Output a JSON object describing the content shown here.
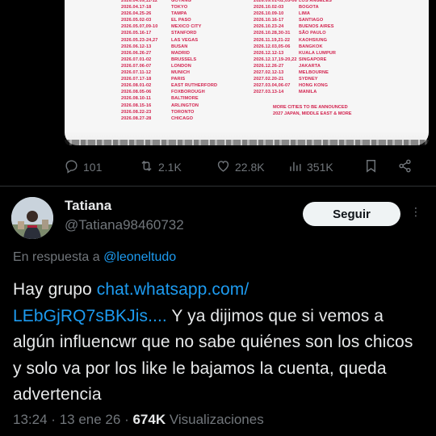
{
  "poster": {
    "left_rows": [
      {
        "date": "2026.04.09,11-12",
        "city": "GOYANG"
      },
      {
        "date": "2026.04.17-18",
        "city": "TOKYO"
      },
      {
        "date": "2026.04.25-26",
        "city": "TAMPA"
      },
      {
        "date": "2026.05.02-03",
        "city": "EL PASO"
      },
      {
        "date": "2026.05.07,09-10",
        "city": "MEXICO CITY"
      },
      {
        "date": "2026.05.16-17",
        "city": "STANFORD"
      },
      {
        "date": "2026.05.23-24,27",
        "city": "LAS VEGAS"
      },
      {
        "date": "2026.06.12-13",
        "city": "BUSAN"
      },
      {
        "date": "2026.06.26-27",
        "city": "MADRID"
      },
      {
        "date": "2026.07.01-02",
        "city": "BRUSSELS"
      },
      {
        "date": "2026.07.06-07",
        "city": "LONDON"
      },
      {
        "date": "2026.07.11-12",
        "city": "MUNICH"
      },
      {
        "date": "2026.07.17-18",
        "city": "PARIS"
      },
      {
        "date": "2026.08.01-02",
        "city": "EAST RUTHERFORD"
      },
      {
        "date": "2026.08.05-06",
        "city": "FOXBOROUGH"
      },
      {
        "date": "2026.08.10-11",
        "city": "BALTIMORE"
      },
      {
        "date": "2026.08.15-16",
        "city": "ARLINGTON"
      },
      {
        "date": "2026.08.22-23",
        "city": "TORONTO"
      },
      {
        "date": "2026.08.27-28",
        "city": "CHICAGO"
      }
    ],
    "right_rows": [
      {
        "date": "2026.09.01-02,05-06",
        "city": "LOS ANGELES"
      },
      {
        "date": "2026.10.02-03",
        "city": "BOGOTA"
      },
      {
        "date": "2026.10.09-10",
        "city": "LIMA"
      },
      {
        "date": "2026.10.16-17",
        "city": "SANTIAGO"
      },
      {
        "date": "2026.10.23-24",
        "city": "BUENOS AIRES"
      },
      {
        "date": "2026.10.28,30-31",
        "city": "SÃO PAULO"
      },
      {
        "date": "2026.11.19,21-22",
        "city": "KAOHSIUNG"
      },
      {
        "date": "2026.12.03,05-06",
        "city": "BANGKOK"
      },
      {
        "date": "2026.12.12-13",
        "city": "KUALA LUMPUR"
      },
      {
        "date": "2026.12.17,19-20,22",
        "city": "SINGAPORE"
      },
      {
        "date": "2026.12.26-27",
        "city": "JAKARTA"
      },
      {
        "date": "2027.02.12-13",
        "city": "MELBOURNE"
      },
      {
        "date": "2027.02.20-21",
        "city": "SYDNEY"
      },
      {
        "date": "2027.03.04,06-07",
        "city": "HONG KONG"
      },
      {
        "date": "2027.03.13-14",
        "city": "MANILA"
      }
    ],
    "note1": "MORE CITIES TO BE ANNOUNCED",
    "note2": "2027 JAPAN, MIDDLE EAST & MORE"
  },
  "actions": {
    "replies": "101",
    "reposts": "2.1K",
    "likes": "22.8K",
    "views": "351K"
  },
  "reply": {
    "name": "Tatiana",
    "handle": "@Tatiana98460732",
    "follow_label": "Seguir",
    "reply_prefix": "En respuesta a",
    "reply_mention": "@leoneltudo",
    "text_before": "Hay grupo ",
    "link_line1": "chat.whatsapp.com/",
    "link_line2": "LEbGjRQ7sBKJis....",
    "text_after": "  Y ya dijimos que si vemos a algún influencwr que no sabe quiénes son los chicos y solo va por los like le bajamos la cuenta,  queda advertencia",
    "time": "13:24",
    "date": "13 ene 26",
    "views_count": "674K",
    "views_label": "Visualizaciones"
  },
  "colors": {
    "background": "#000000",
    "text": "#e7e9ea",
    "muted": "#71767b",
    "link": "#1d9bf0",
    "poster_red": "#d2224e"
  }
}
